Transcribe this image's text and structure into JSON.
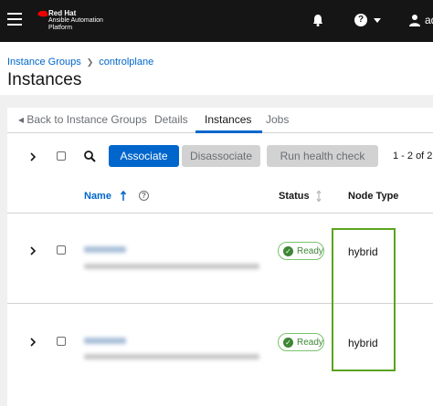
{
  "brand": {
    "line1": "Red Hat",
    "line2": "Ansible Automation",
    "line3": "Platform"
  },
  "masthead": {
    "user_name": "ad"
  },
  "breadcrumb": {
    "items": [
      "Instance Groups",
      "controlplane"
    ]
  },
  "page": {
    "title": "Instances"
  },
  "tabs": [
    {
      "label": "◂ Back to Instance Groups"
    },
    {
      "label": "Details"
    },
    {
      "label": "Instances"
    },
    {
      "label": "Jobs"
    }
  ],
  "toolbar": {
    "associate_label": "Associate",
    "disassociate_label": "Disassociate",
    "health_check_label": "Run health check",
    "pagination": "1 - 2 of 2"
  },
  "table": {
    "columns": [
      "Name",
      "Status",
      "Node Type"
    ],
    "rows": [
      {
        "status": "Ready",
        "node_type": "hybrid"
      },
      {
        "status": "Ready",
        "node_type": "hybrid"
      }
    ]
  },
  "colors": {
    "accent": "#0066cc",
    "masthead": "#151515",
    "highlight": "#5ba41d",
    "success": "#3e8635"
  }
}
